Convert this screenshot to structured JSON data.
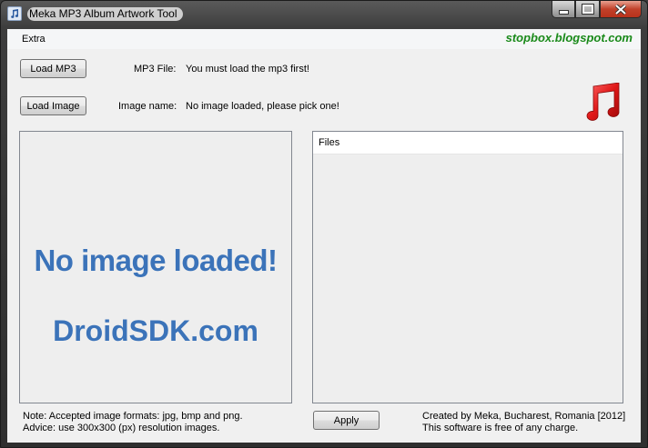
{
  "window": {
    "title": "Meka MP3 Album Artwork Tool"
  },
  "menu": {
    "items": [
      "Extra"
    ]
  },
  "header": {
    "blog": "stopbox.blogspot.com"
  },
  "mp3": {
    "button": "Load MP3",
    "label": "MP3 File:",
    "value": "You must load the mp3 first!"
  },
  "image": {
    "button": "Load Image",
    "label": "Image name:",
    "value": "No image loaded, please pick one!"
  },
  "preview": {
    "line1": "No image loaded!",
    "line2": "DroidSDK.com"
  },
  "files": {
    "header": "Files",
    "items": []
  },
  "apply": {
    "button": "Apply"
  },
  "notes": {
    "formats": "Note: Accepted image formats: jpg, bmp  and png.",
    "advice": "Advice: use 300x300 (px) resolution images."
  },
  "credits": {
    "author": "Created by Meka, Bucharest, Romania [2012]",
    "license": "This software is free of any charge."
  },
  "colors": {
    "accent": "#3b73b9",
    "blog_green": "#1a8a1a",
    "music_red": "#d81c1c"
  },
  "icons": [
    "music-note-icon",
    "minimize-icon",
    "maximize-icon",
    "close-icon"
  ]
}
